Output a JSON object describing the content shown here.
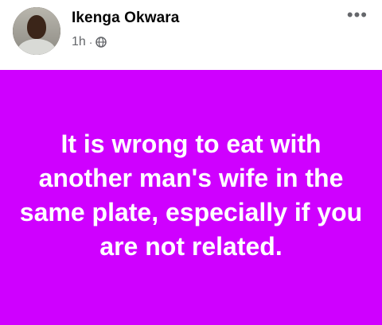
{
  "post": {
    "author": "Ikenga Okwara",
    "time": "1h",
    "separator": "·",
    "privacy_icon": "globe-icon",
    "more_icon": "more-options-icon",
    "more_label": "•••",
    "text": "It is wrong to eat with another man's wife in the same plate, especially if you are not related.",
    "background_color": "#cf00ff",
    "text_color": "#ffffff"
  }
}
